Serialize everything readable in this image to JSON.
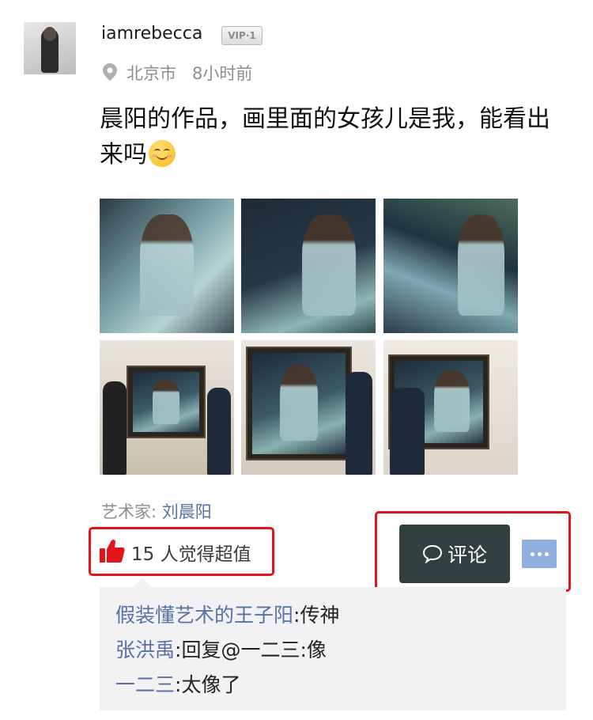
{
  "user": {
    "name": "iamrebecca",
    "vip_badge": "VIP·1",
    "location": "北京市",
    "time_ago": "8小时前"
  },
  "post": {
    "text": "晨阳的作品，画里面的女孩儿是我，能看出来吗",
    "emoji": "smiling-face-emoji",
    "photos": [
      "painting-detail-1",
      "painting-detail-2",
      "painting-detail-3",
      "photo-with-painting-1",
      "photo-with-painting-2",
      "photo-with-painting-3"
    ]
  },
  "artist": {
    "label": "艺术家:",
    "name": "刘晨阳"
  },
  "likes": {
    "count": "15",
    "text": "人觉得超值",
    "icon": "thumbs-up-icon"
  },
  "actions": {
    "comment_label": "评论",
    "comment_icon": "speech-bubble-icon",
    "more_icon": "ellipsis-icon"
  },
  "comments": [
    {
      "author": "假装懂艺术的王子阳",
      "text": ":传神"
    },
    {
      "author": "张洪禹",
      "text": ":回复@一二三:像"
    },
    {
      "author": "一二三",
      "text": ":太像了"
    }
  ],
  "colors": {
    "link": "#5672a6",
    "highlight_box": "#e3141b",
    "comment_button": "#30403f",
    "more_button": "#8fb0df",
    "thumb": "#e3141b"
  }
}
